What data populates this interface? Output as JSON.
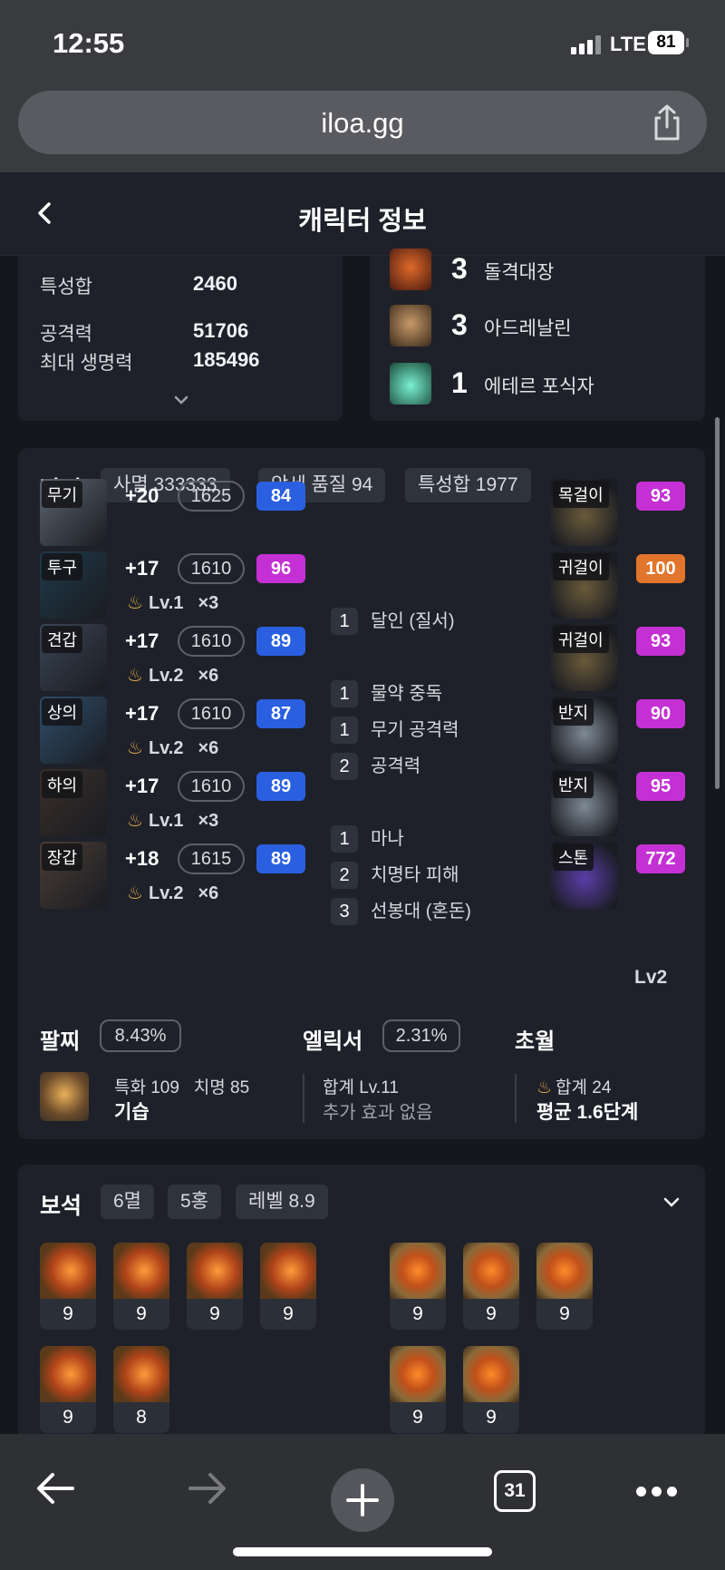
{
  "status_bar": {
    "time": "12:55",
    "network": "LTE",
    "battery": "81"
  },
  "browser": {
    "url": "iloa.gg",
    "tab_count": "31"
  },
  "header": {
    "title": "캐릭터 정보"
  },
  "stats": {
    "rows": [
      {
        "label": "특성합",
        "value": "2460"
      },
      {
        "label": "공격력",
        "value": "51706"
      },
      {
        "label": "최대 생명력",
        "value": "185496"
      }
    ]
  },
  "engravings": [
    {
      "level": "3",
      "name": "돌격대장",
      "color": "#b84a2a"
    },
    {
      "level": "3",
      "name": "아드레날린",
      "color": "#8a6a4a"
    },
    {
      "level": "1",
      "name": "에테르 포식자",
      "color": "#3aa88a"
    }
  ],
  "equipment": {
    "title": "장비",
    "tags": [
      "사멸 333333",
      "악세 품질 94",
      "특성합 1977"
    ],
    "armor": [
      {
        "slot": "무기",
        "refine": "+20",
        "ilvl": "1625",
        "quality": "84",
        "qcolor": "blue",
        "lv": "",
        "mult": "",
        "color": "#5d6670"
      },
      {
        "slot": "투구",
        "refine": "+17",
        "ilvl": "1610",
        "quality": "96",
        "qcolor": "purple",
        "lv": "Lv.1",
        "mult": "×3",
        "color": "#1f3a4a"
      },
      {
        "slot": "견갑",
        "refine": "+17",
        "ilvl": "1610",
        "quality": "89",
        "qcolor": "blue",
        "lv": "Lv.2",
        "mult": "×6",
        "color": "#3b4656"
      },
      {
        "slot": "상의",
        "refine": "+17",
        "ilvl": "1610",
        "quality": "87",
        "qcolor": "blue",
        "lv": "Lv.2",
        "mult": "×6",
        "color": "#2f4e6a"
      },
      {
        "slot": "하의",
        "refine": "+17",
        "ilvl": "1610",
        "quality": "89",
        "qcolor": "blue",
        "lv": "Lv.1",
        "mult": "×3",
        "color": "#3a2f2a"
      },
      {
        "slot": "장갑",
        "refine": "+18",
        "ilvl": "1615",
        "quality": "89",
        "qcolor": "blue",
        "lv": "Lv.2",
        "mult": "×6",
        "color": "#4a3d36"
      }
    ],
    "engrave_effects": [
      {
        "n": "1",
        "name": "달인 (질서)"
      },
      {
        "n": "1",
        "name": "물약 중독"
      },
      {
        "n": "1",
        "name": "무기 공격력"
      },
      {
        "n": "2",
        "name": "공격력"
      },
      {
        "n": "1",
        "name": "마나"
      },
      {
        "n": "2",
        "name": "치명타 피해"
      },
      {
        "n": "3",
        "name": "선봉대 (혼돈)"
      }
    ],
    "accessories": [
      {
        "slot": "목걸이",
        "quality": "93",
        "qcolor": "purple",
        "color": "#6a5a3a"
      },
      {
        "slot": "귀걸이",
        "quality": "100",
        "qcolor": "orange",
        "color": "#6a5a3a"
      },
      {
        "slot": "귀걸이",
        "quality": "93",
        "qcolor": "purple",
        "color": "#6a5a3a"
      },
      {
        "slot": "반지",
        "quality": "90",
        "qcolor": "purple",
        "color": "#7e8a96"
      },
      {
        "slot": "반지",
        "quality": "95",
        "qcolor": "purple",
        "color": "#7e8a96"
      },
      {
        "slot": "스톤",
        "quality": "772",
        "qcolor": "purple",
        "color": "#5a3ea8"
      }
    ],
    "stone_level": "Lv2"
  },
  "bracelet": {
    "title": "팔찌",
    "percent": "8.43%",
    "stats": "특화 109   치명 85",
    "effect": "기습"
  },
  "elixir": {
    "title": "엘릭서",
    "percent": "2.31%",
    "total": "합계 Lv.11",
    "extra": "추가 효과 없음"
  },
  "transcend": {
    "title": "초월",
    "total": "합계 24",
    "avg": "평균 1.6단계"
  },
  "gems": {
    "title": "보석",
    "tags": [
      "6멸",
      "5홍",
      "레벨 8.9"
    ],
    "row1_left": [
      "9",
      "9",
      "9",
      "9"
    ],
    "row1_right": [
      "9",
      "9",
      "9"
    ],
    "row2_left": [
      "9",
      "8"
    ],
    "row2_right": [
      "9",
      "9"
    ]
  }
}
